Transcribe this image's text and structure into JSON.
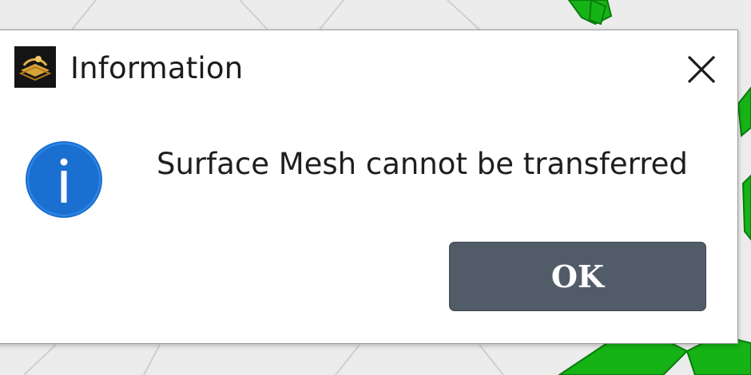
{
  "dialog": {
    "title": "Information",
    "app_icon": "app-logo-icon",
    "close_icon": "close-icon",
    "status_icon": "info-icon",
    "message": "Surface Mesh cannot be transferred",
    "ok_label": "OK"
  },
  "colors": {
    "info_icon_fill": "#1a6fd0",
    "ok_button_bg": "#525b68",
    "background_mesh": "#16b316"
  }
}
